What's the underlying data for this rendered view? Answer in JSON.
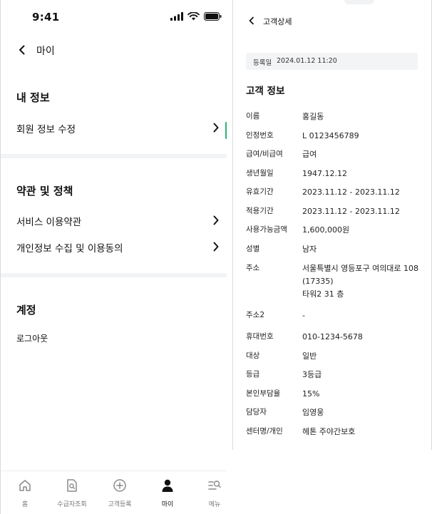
{
  "colors": {
    "accent_green": "#2bb673",
    "divider": "#f2f3f5",
    "info_box": "#f3f4f6"
  },
  "left_screen": {
    "status_bar": {
      "time": "9:41",
      "icons": [
        "signal-icon",
        "wifi-icon",
        "battery-icon"
      ]
    },
    "header": {
      "title": "마이",
      "back_icon": "chevron-left-icon"
    },
    "sections": {
      "my_info": {
        "title": "내 정보",
        "items": [
          {
            "label": "회원 정보 수정"
          }
        ]
      },
      "terms": {
        "title": "약관 및 정책",
        "items": [
          {
            "label": "서비스 이용약관"
          },
          {
            "label": "개인정보 수집 및 이용동의"
          }
        ]
      },
      "account": {
        "title": "계정",
        "logout": "로그아웃"
      }
    },
    "bottom_nav": [
      {
        "label": "홈",
        "icon": "home-icon"
      },
      {
        "label": "수급자조회",
        "icon": "document-search-icon"
      },
      {
        "label": "고객등록",
        "icon": "add-circle-icon"
      },
      {
        "label": "마이",
        "icon": "user-icon",
        "active": true
      },
      {
        "label": "메뉴",
        "icon": "menu-search-icon"
      }
    ]
  },
  "right_screen": {
    "header": {
      "title": "고객상세",
      "back_icon": "chevron-left-icon"
    },
    "registration": {
      "label": "등록일",
      "value": "2024.01.12 11:20"
    },
    "section_title": "고객 정보",
    "rows": [
      {
        "label": "이름",
        "value": "홍길동"
      },
      {
        "label": "인정번호",
        "value": "L 0123456789"
      },
      {
        "label": "급여/비급여",
        "value": "급여"
      },
      {
        "label": "생년월일",
        "value": "1947.12.12"
      },
      {
        "label": "유효기간",
        "value": "2023.11.12 - 2023.11.12"
      },
      {
        "label": "적용기간",
        "value": "2023.11.12 - 2023.11.12"
      },
      {
        "label": "사용가능금액",
        "value": "1,600,000원"
      },
      {
        "label": "성별",
        "value": "남자"
      },
      {
        "label": "주소",
        "value_lines": [
          "서울특별시 영등포구 여의대로 108",
          "(17335)",
          "타워2 31 층"
        ]
      },
      {
        "label": "주소2",
        "value": "-"
      },
      {
        "label": "휴대번호",
        "value": "010-1234-5678"
      },
      {
        "label": "대상",
        "value": "일반"
      },
      {
        "label": "등급",
        "value": "3등급"
      },
      {
        "label": "본인부담율",
        "value": "15%"
      },
      {
        "label": "담당자",
        "value": "임영웅"
      },
      {
        "label": "센터명/개인",
        "value": "헤톤 주야간보호"
      }
    ]
  }
}
